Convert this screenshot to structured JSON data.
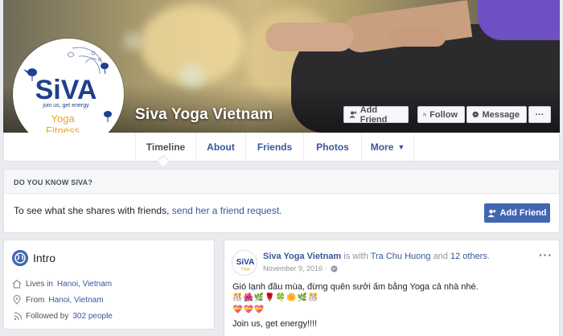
{
  "page": {
    "name": "Siva Yoga Vietnam",
    "logo": {
      "brand": "SiVA",
      "tagline": "join us, get energy",
      "line1": "Yoga",
      "line2": "Fitness"
    }
  },
  "cover_actions": {
    "add_friend": "Add Friend",
    "follow": "Follow",
    "message": "Message",
    "more": "···"
  },
  "nav": {
    "tabs": [
      {
        "label": "Timeline"
      },
      {
        "label": "About"
      },
      {
        "label": "Friends"
      },
      {
        "label": "Photos"
      },
      {
        "label": "More"
      }
    ]
  },
  "know": {
    "heading": "DO YOU KNOW SIVA?",
    "text": "To see what she shares with friends, ",
    "link": "send her a friend request.",
    "button": "Add Friend"
  },
  "intro": {
    "title": "Intro",
    "lives_prefix": "Lives in ",
    "lives_link": "Hanoi, Vietnam",
    "from_prefix": "From ",
    "from_link": "Hanoi, Vietnam",
    "followed_prefix": "Followed by ",
    "followed_link": "302 people"
  },
  "post": {
    "author": "Siva Yoga Vietnam",
    "with_text": " is with ",
    "with_person": "Tra Chu Huong",
    "and_text": " and ",
    "others": "12 others",
    "period": ".",
    "date": "November 9, 2016 ·",
    "line1": "Gió lạnh đầu mùa, đừng quên sưởi ấm bằng Yoga cả nhà nhé.",
    "emoji_row1": "🎊🌺🌿🌹🍀🌼🌿🎊",
    "emoji_row2": "💝💝💝",
    "line2": "Join us, get energy!!!!",
    "more": "···"
  },
  "colors": {
    "brand_blue": "#4267b2",
    "link": "#365899",
    "logo_navy": "#1f3f8f",
    "logo_orange": "#f3a21b"
  }
}
